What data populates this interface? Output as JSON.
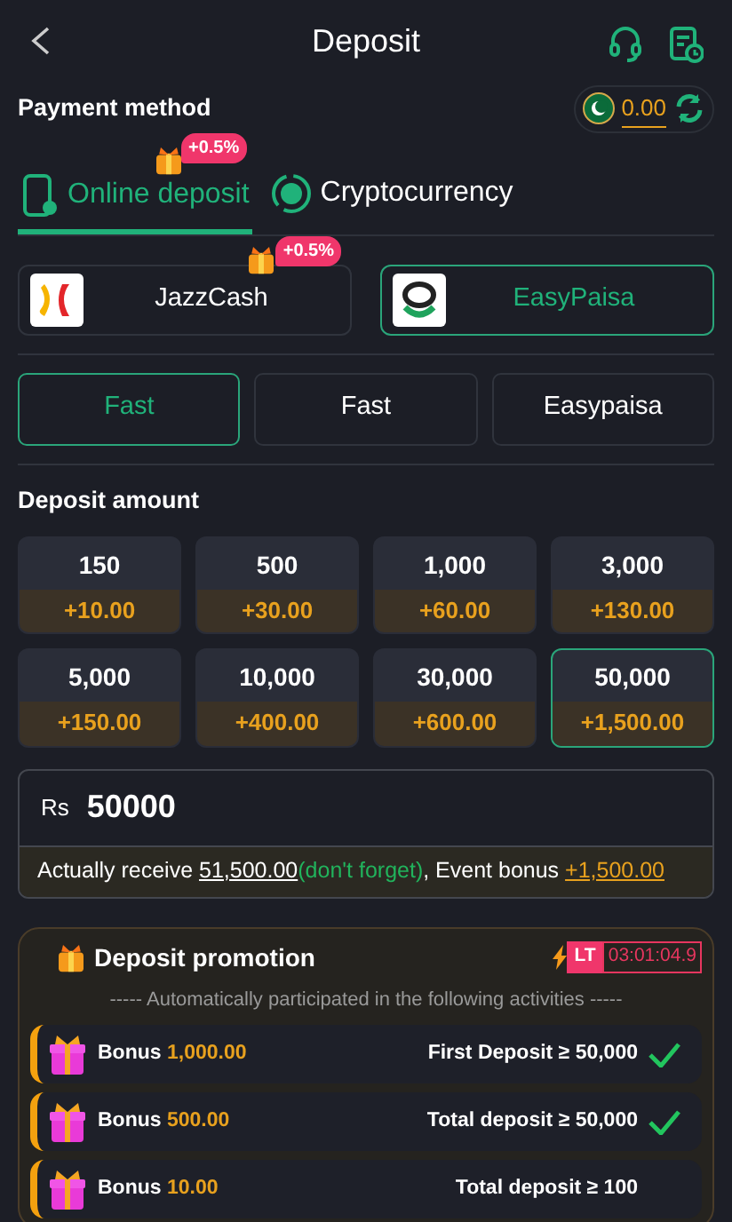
{
  "header": {
    "title": "Deposit"
  },
  "payment_method": {
    "label": "Payment method",
    "balance": "0.00"
  },
  "method_tabs": [
    {
      "label": "Online deposit",
      "selected": true,
      "badge": "+0.5%",
      "kind": "phone"
    },
    {
      "label": "Cryptocurrency",
      "selected": false,
      "kind": "coin"
    }
  ],
  "channels": [
    {
      "name": "JazzCash",
      "selected": false,
      "badge": "+0.5%",
      "kind": "jazz"
    },
    {
      "name": "EasyPaisa",
      "selected": true,
      "kind": "easy"
    }
  ],
  "sub_channels": [
    {
      "label": "Fast",
      "selected": true
    },
    {
      "label": "Fast",
      "selected": false
    },
    {
      "label": "Easypaisa",
      "selected": false
    }
  ],
  "deposit_amount": {
    "label": "Deposit amount",
    "options": [
      {
        "amount": "150",
        "bonus": "+10.00",
        "selected": false
      },
      {
        "amount": "500",
        "bonus": "+30.00",
        "selected": false
      },
      {
        "amount": "1,000",
        "bonus": "+60.00",
        "selected": false
      },
      {
        "amount": "3,000",
        "bonus": "+130.00",
        "selected": false
      },
      {
        "amount": "5,000",
        "bonus": "+150.00",
        "selected": false
      },
      {
        "amount": "10,000",
        "bonus": "+400.00",
        "selected": false
      },
      {
        "amount": "30,000",
        "bonus": "+600.00",
        "selected": false
      },
      {
        "amount": "50,000",
        "bonus": "+1,500.00",
        "selected": true
      }
    ]
  },
  "amount_input": {
    "currency": "Rs",
    "value": "50000"
  },
  "receive_note": {
    "prefix": "Actually receive",
    "total": "51,500.00",
    "reminder": "(don't forget)",
    "bonus_label": ", Event bonus",
    "bonus": "+1,500.00"
  },
  "promotion": {
    "title": "Deposit promotion",
    "tag": "LT",
    "timer": "03:01:04.9",
    "subtitle": "----- Automatically participated in the following activities -----",
    "items": [
      {
        "label": "Bonus",
        "amount": "1,000.00",
        "condition": "First Deposit ≥ 50,000",
        "done": true
      },
      {
        "label": "Bonus",
        "amount": "500.00",
        "condition": "Total deposit ≥ 50,000",
        "done": true
      },
      {
        "label": "Bonus",
        "amount": "10.00",
        "condition": "Total deposit ≥ 100",
        "done": false
      }
    ]
  }
}
